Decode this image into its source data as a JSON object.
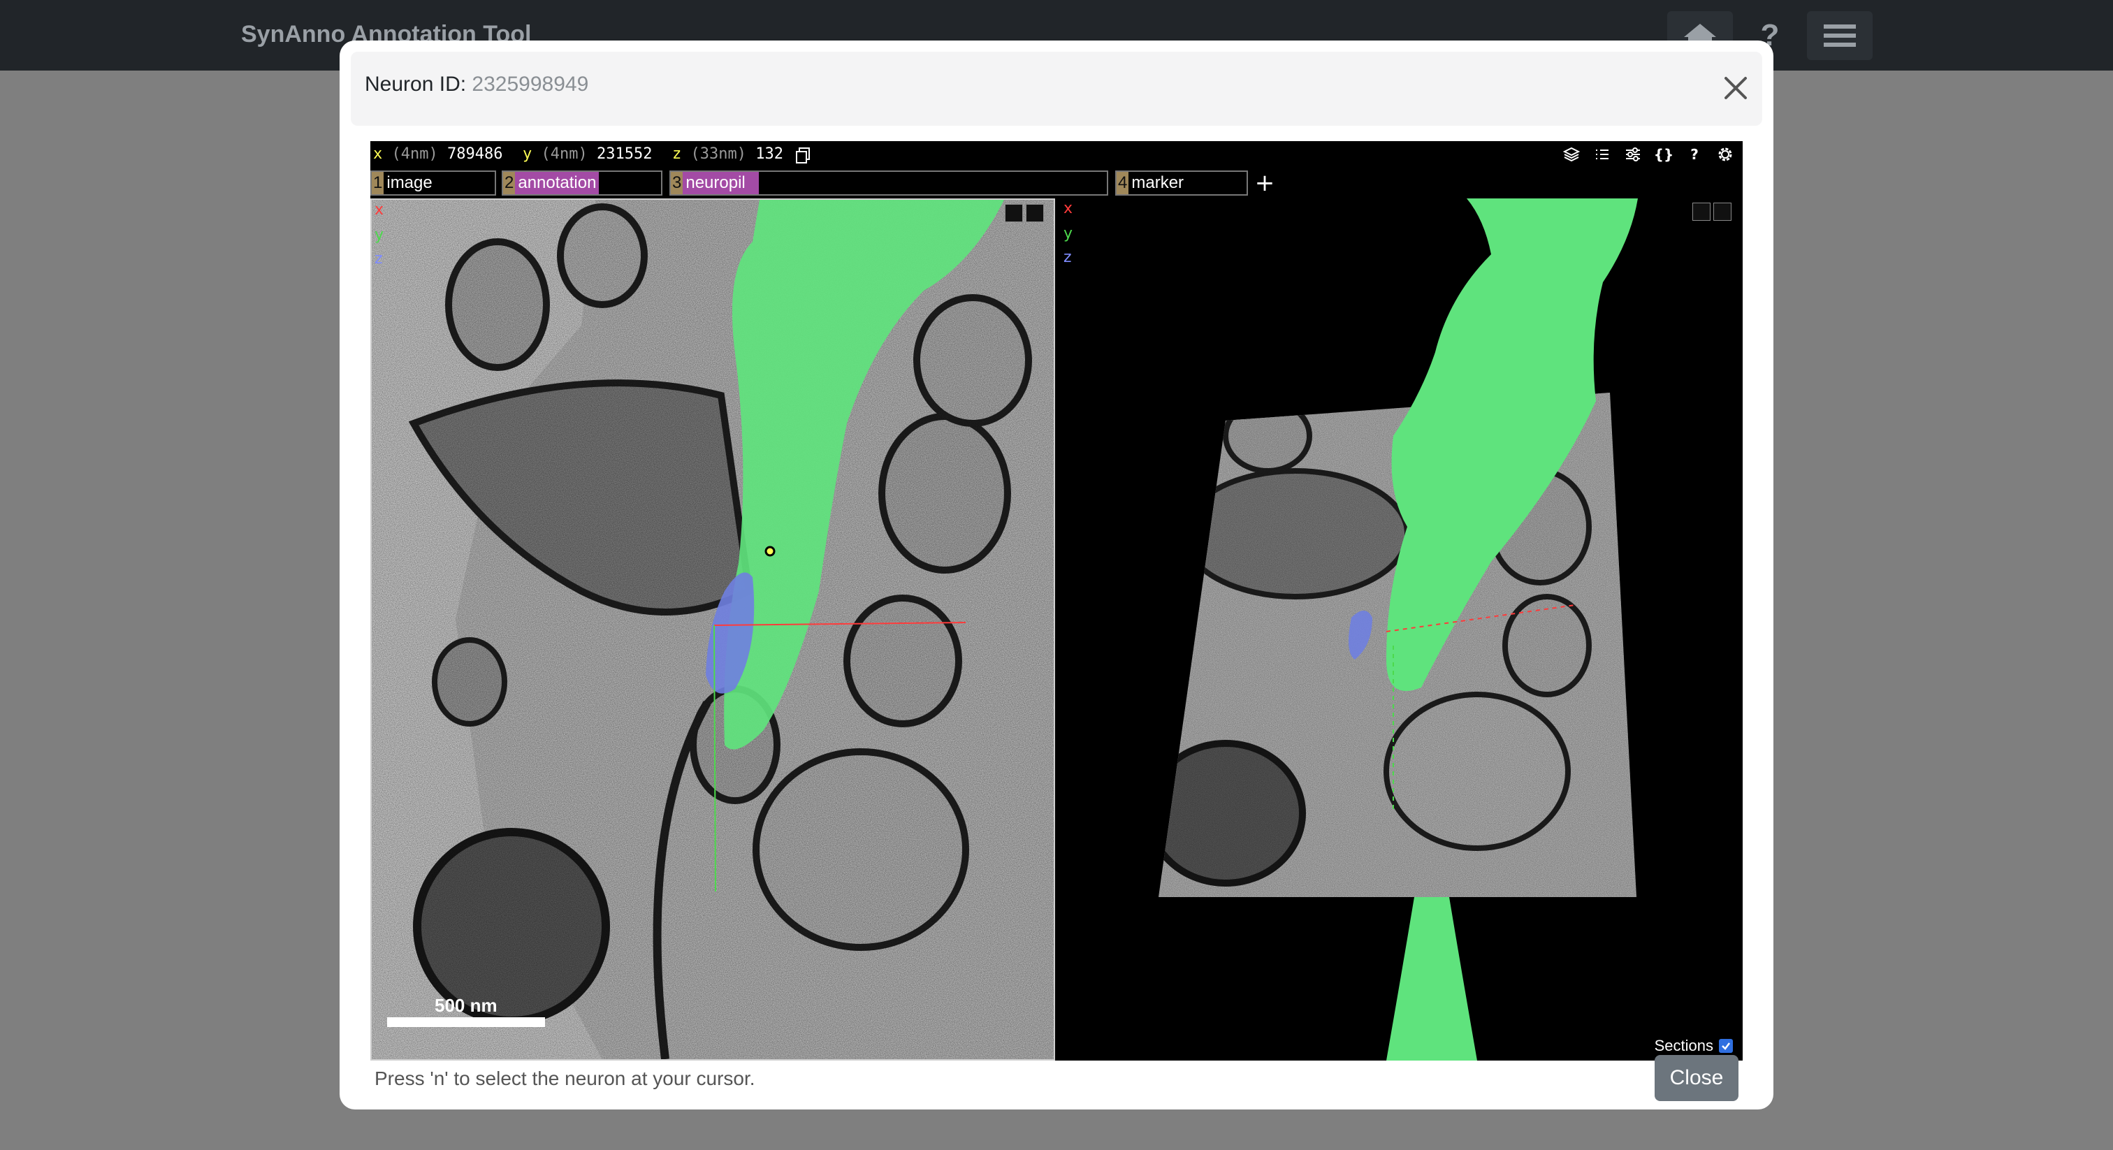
{
  "app": {
    "title": "SynAnno Annotation Tool"
  },
  "navbar": {
    "icons": [
      "home-icon",
      "help-icon",
      "menu-icon"
    ],
    "help_glyph": "?"
  },
  "modal": {
    "title_label": "Neuron ID:",
    "neuron_id": "2325998949",
    "footer_hint": "Press 'n' to select the neuron at your cursor.",
    "close_label": "Close"
  },
  "viewer": {
    "coords": [
      {
        "axis": "x",
        "unit": "(4nm)",
        "value": "789486"
      },
      {
        "axis": "y",
        "unit": "(4nm)",
        "value": "231552"
      },
      {
        "axis": "z",
        "unit": "(33nm)",
        "value": "132"
      }
    ],
    "toolbar_icons": [
      "layers-icon",
      "list-icon",
      "sliders-icon",
      "json-icon",
      "help-icon",
      "settings-icon"
    ],
    "toolbar_json_glyph": "{}",
    "toolbar_help_glyph": "?",
    "layers": [
      {
        "num": "1",
        "name": "image",
        "color": "#a0885a"
      },
      {
        "num": "2",
        "name": "annotation",
        "color": "#a34ba5"
      },
      {
        "num": "3",
        "name": "neuropil",
        "color": "#a34ba5"
      },
      {
        "num": "4",
        "name": "marker",
        "color": "#a0885a"
      }
    ],
    "add_layer_glyph": "+",
    "axis_labels": [
      "x",
      "y",
      "z"
    ],
    "scale_bar": "500 nm",
    "sections_label": "Sections",
    "sections_checked": true,
    "colors": {
      "segment": "#5fe37d",
      "synapse": "#6f7fe0",
      "x_axis": "#ff3b3b",
      "y_axis": "#4cd94c",
      "z_axis": "#7f8cff"
    }
  }
}
